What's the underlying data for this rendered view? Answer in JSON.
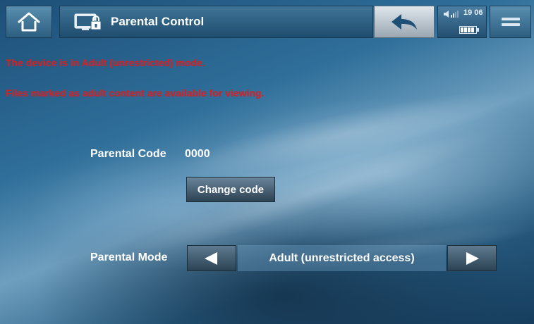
{
  "header": {
    "title": "Parental Control",
    "icons": {
      "home": "home-icon",
      "title": "parental-lock-icon",
      "back": "back-arrow-icon",
      "menu": "menu-icon"
    }
  },
  "status": {
    "time": "19 06",
    "volume_icon": "volume-icon",
    "battery_icon": "battery-icon"
  },
  "messages": {
    "mode_notice": "The device is in Adult (unrestricted) mode.",
    "availability_notice": "Files marked as adult content are available for viewing."
  },
  "code": {
    "label": "Parental Code",
    "value": "0000",
    "change_button": "Change code"
  },
  "mode": {
    "label": "Parental Mode",
    "value": "Adult (unrestricted access)"
  },
  "colors": {
    "warning": "#e21b1b",
    "accent": "#2c5e80"
  }
}
